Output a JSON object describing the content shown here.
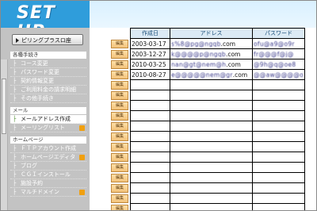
{
  "header": {
    "logo_text": "SET UP"
  },
  "sidebar": {
    "pill_label": "ピリングプラスロ座",
    "sections": [
      {
        "title": "各種手続き",
        "items": [
          {
            "label": "コース変更"
          },
          {
            "label": "パスワード変更"
          },
          {
            "label": "契約情報変更"
          },
          {
            "label": "ご利用料金の請求明細"
          },
          {
            "label": "その他手続き"
          }
        ]
      },
      {
        "title": "メール",
        "items": [
          {
            "label": "メールアドレス作成",
            "active": true
          },
          {
            "label": "メーリングリスト"
          }
        ]
      },
      {
        "title": "ホームページ",
        "items": [
          {
            "label": "ＦＴＰアカウント作成"
          },
          {
            "label": "ホームページエディタ"
          },
          {
            "label": "ブログ"
          },
          {
            "label": "ＣＧＩインストール"
          },
          {
            "label": "施設予約"
          },
          {
            "label": "マルチドメイン"
          }
        ]
      }
    ]
  },
  "table": {
    "headers": [
      "作成日",
      "アドレス",
      "パスワード"
    ],
    "edit_label": "編集",
    "rows": [
      {
        "date": "2003-03-17",
        "address_masked": "s%8@pg@ngqb",
        "address_domain": ".com",
        "password_masked": "ofu@a9@o9r"
      },
      {
        "date": "2003-12-27",
        "address_masked": "k@@@@p@ngqb",
        "address_domain": ".com",
        "password_masked": "fr@@@f@j@"
      },
      {
        "date": "2010-03-25",
        "address_masked": "nan@gt@nem@h",
        "address_domain": ".com",
        "password_masked": "@9h@q@oe8"
      },
      {
        "date": "2010-08-27",
        "address_masked": "e@@@@@nem@gr",
        "address_domain": ".com",
        "password_masked": "@@aw@@@@o"
      },
      {
        "date": "",
        "address_masked": "",
        "address_domain": "",
        "password_masked": ""
      },
      {
        "date": "",
        "address_masked": "",
        "address_domain": "",
        "password_masked": ""
      },
      {
        "date": "",
        "address_masked": "",
        "address_domain": "",
        "password_masked": ""
      },
      {
        "date": "",
        "address_masked": "",
        "address_domain": "",
        "password_masked": ""
      },
      {
        "date": "",
        "address_masked": "",
        "address_domain": "",
        "password_masked": ""
      },
      {
        "date": "",
        "address_masked": "",
        "address_domain": "",
        "password_masked": ""
      },
      {
        "date": "",
        "address_masked": "",
        "address_domain": "",
        "password_masked": ""
      },
      {
        "date": "",
        "address_masked": "",
        "address_domain": "",
        "password_masked": ""
      },
      {
        "date": "",
        "address_masked": "",
        "address_domain": "",
        "password_masked": ""
      },
      {
        "date": "",
        "address_masked": "",
        "address_domain": "",
        "password_masked": ""
      },
      {
        "date": "",
        "address_masked": "",
        "address_domain": "",
        "password_masked": ""
      },
      {
        "date": "",
        "address_masked": "",
        "address_domain": "",
        "password_masked": ""
      },
      {
        "date": "",
        "address_masked": "",
        "address_domain": "",
        "password_masked": ""
      }
    ]
  },
  "colors": {
    "header_blue": "#2f9ddb",
    "sidebar_gray": "#c3c3c3",
    "edit_button": "#f2c27a",
    "table_header": "#dceaf5"
  }
}
